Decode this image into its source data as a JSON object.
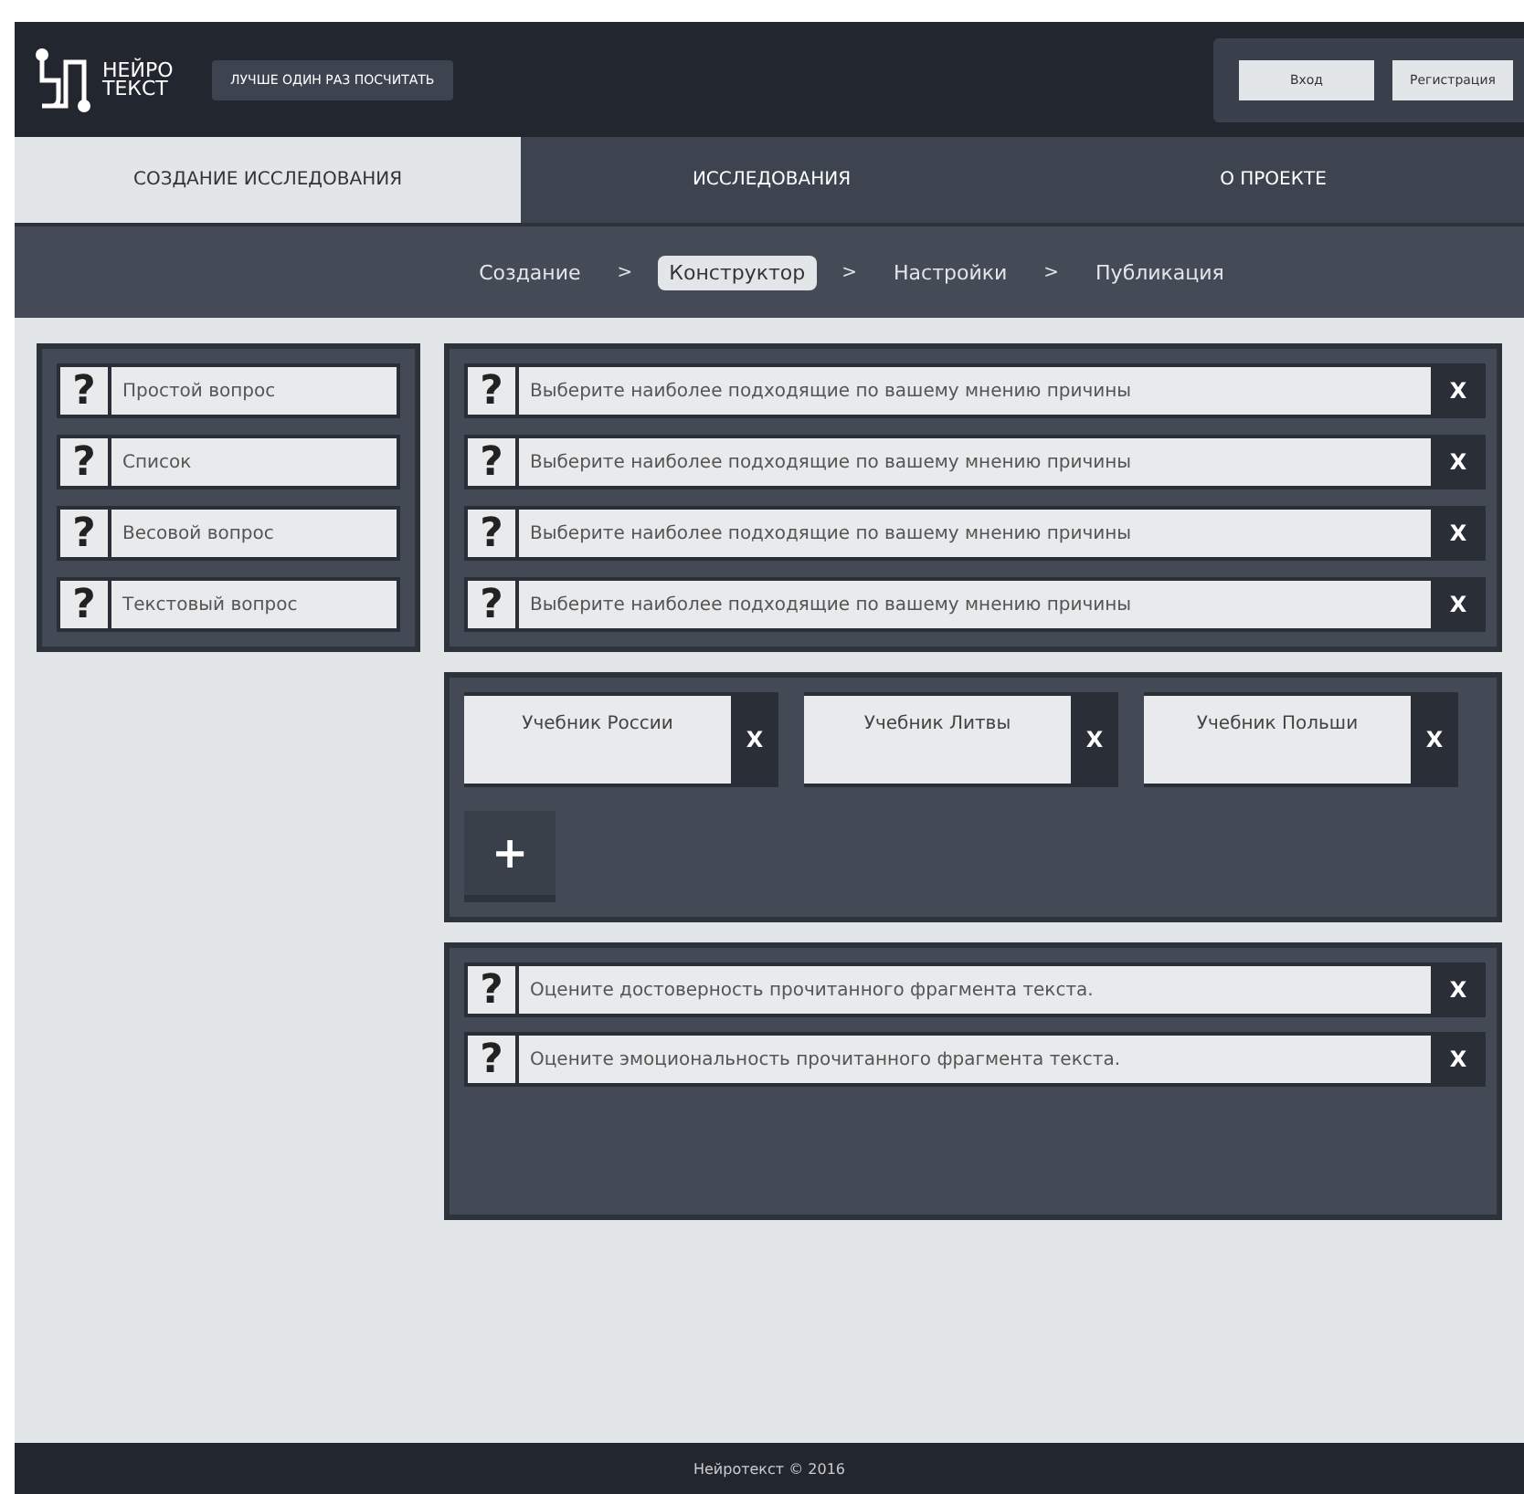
{
  "header": {
    "logo": "НЕЙРО ТЕКСТ",
    "slogan": "ЛУЧШЕ ОДИН РАЗ ПОСЧИТАТЬ",
    "buttons": [
      "Вход",
      "Регистрация"
    ]
  },
  "tabs": [
    {
      "label": "СОЗДАНИЕ ИССЛЕДОВАНИЯ",
      "selected": true
    },
    {
      "label": "ИССЛЕДОВАНИЯ",
      "selected": false
    },
    {
      "label": "О ПРОЕКТЕ",
      "selected": false
    }
  ],
  "steps": {
    "separator": ">",
    "items": [
      {
        "label": "Создание",
        "selected": false
      },
      {
        "label": "Конструктор",
        "selected": true
      },
      {
        "label": "Настройки",
        "selected": false
      },
      {
        "label": "Публикация",
        "selected": false
      }
    ]
  },
  "question_types": [
    {
      "icon": "?",
      "label": "Простой вопрос"
    },
    {
      "icon": "?",
      "label": "Список"
    },
    {
      "icon": "?",
      "label": "Весовой вопрос"
    },
    {
      "icon": "?",
      "label": "Текстовый вопрос"
    }
  ],
  "question_list": [
    {
      "icon": "?",
      "text": "Выберите наиболее подходящие по вашему мнению причины",
      "remove": "X"
    },
    {
      "icon": "?",
      "text": "Выберите наиболее подходящие по вашему мнению причины",
      "remove": "X"
    },
    {
      "icon": "?",
      "text": "Выберите наиболее подходящие по вашему мнению причины",
      "remove": "X"
    },
    {
      "icon": "?",
      "text": "Выберите наиболее подходящие по вашему мнению причины",
      "remove": "X"
    }
  ],
  "options": {
    "items": [
      {
        "text": "Учебник России",
        "remove": "X"
      },
      {
        "text": "Учебник Литвы",
        "remove": "X"
      },
      {
        "text": "Учебник Польши",
        "remove": "X"
      }
    ],
    "add": "+"
  },
  "rating_list": [
    {
      "icon": "?",
      "text": "Оцените достоверность прочитанного фрагмента текста.",
      "remove": "X"
    },
    {
      "icon": "?",
      "text": "Оцените эмоциональность прочитанного фрагмента текста.",
      "remove": "X"
    }
  ],
  "footer": "Нейротекст © 2016"
}
